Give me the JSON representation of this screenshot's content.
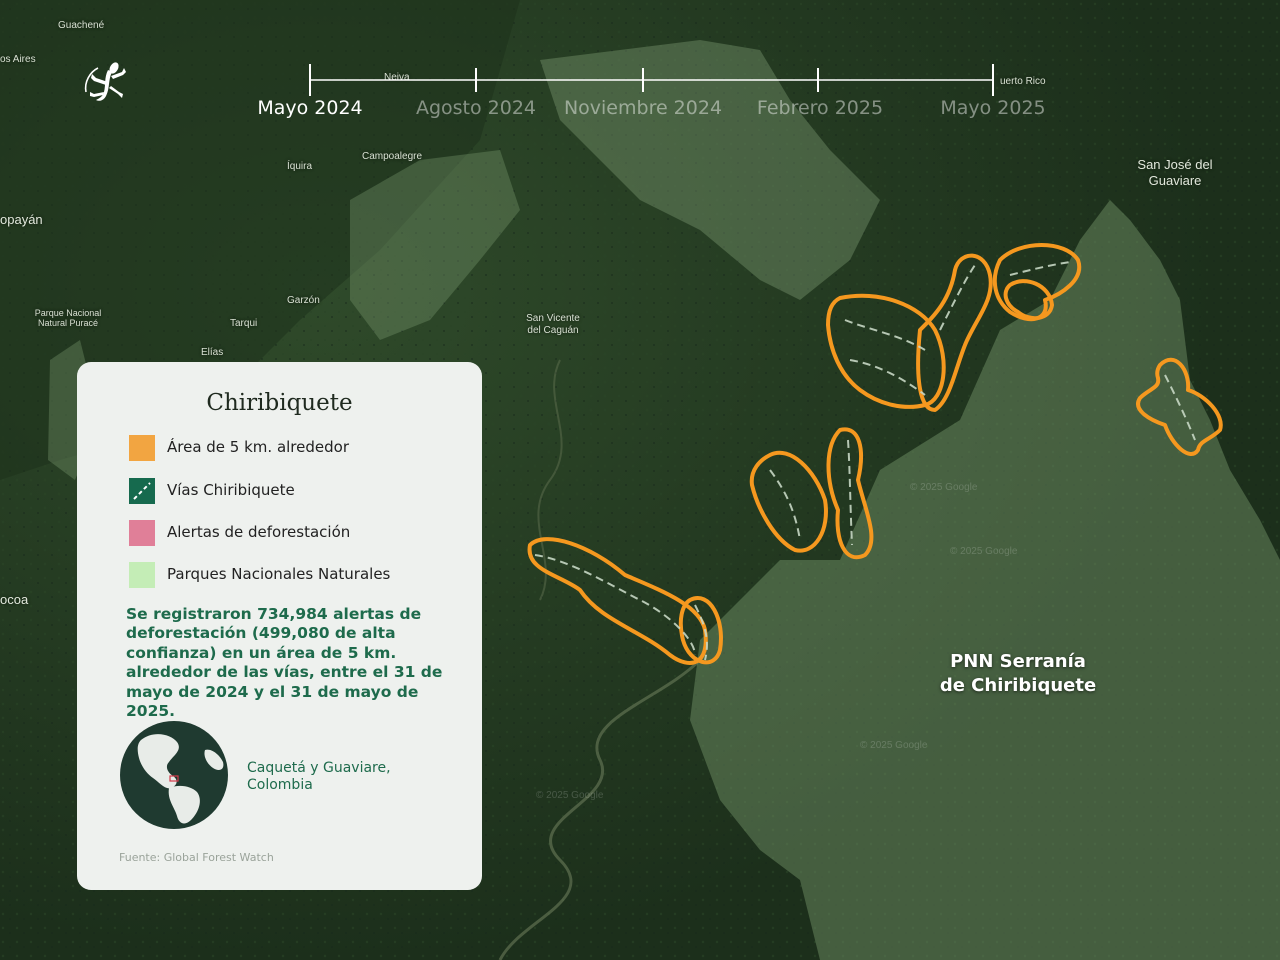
{
  "timeline": {
    "labels": [
      "Mayo 2024",
      "Agosto 2024",
      "Noviembre 2024",
      "Febrero 2025",
      "Mayo 2025"
    ],
    "active_index": 0
  },
  "map": {
    "places": {
      "guachene": "Guachené",
      "buenos_aires": "os Aires",
      "neiva": "Neiva",
      "puerto_rico": "uerto Rico",
      "iquira": "Íquira",
      "campoalegre": "Campoalegre",
      "popayan": "opayán",
      "garzon": "Garzón",
      "san_jose_1": "San José del",
      "san_jose_2": "Guaviare",
      "parque_purace_1": "Parque Nacional",
      "parque_purace_2": "Natural Puracé",
      "tarqui": "Tarqui",
      "san_vicente_1": "San Vicente",
      "san_vicente_2": "del Caguán",
      "elias": "Elías",
      "mocoa": "ocoa"
    },
    "watermark": "© 2025 Google",
    "park_label_line1": "PNN Serranía",
    "park_label_line2": "de Chiribiquete",
    "colors": {
      "buffer": "#f5981f",
      "road": "#c7d7c4",
      "park_overlay": "#7f9f73"
    }
  },
  "legend": {
    "title": "Chiribiquete",
    "items": [
      {
        "label": "Área de 5 km. alrededor",
        "color": "#f2a541",
        "icon": "area-swatch"
      },
      {
        "label": "Vías Chiribiquete",
        "color": "#166a4e",
        "icon": "road-swatch"
      },
      {
        "label": "Alertas de deforestación",
        "color": "#e07f98",
        "icon": "alert-swatch"
      },
      {
        "label": "Parques Nacionales Naturales",
        "color": "#c4edb6",
        "icon": "park-swatch"
      }
    ],
    "summary": "Se registraron 734,984 alertas de deforestación (499,080 de alta confianza) en un área de 5 km. alrededor de las vías, entre el 31 de mayo de 2024 y el 31 de mayo de 2025.",
    "region_line1": "Caquetá y Guaviare,",
    "region_line2": "Colombia",
    "source": "Fuente: Global Forest Watch"
  }
}
